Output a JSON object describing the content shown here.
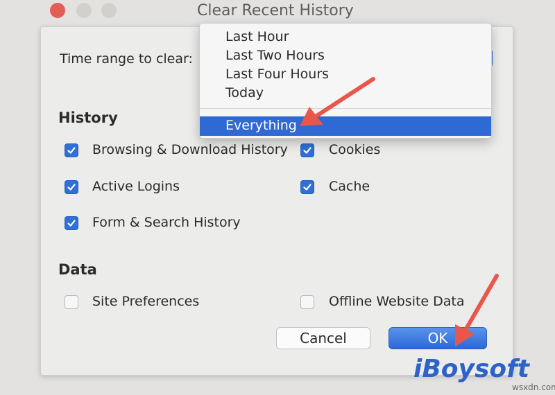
{
  "window": {
    "title": "Clear Recent History"
  },
  "time_range": {
    "label": "Time range to clear:",
    "options": [
      "Last Hour",
      "Last Two Hours",
      "Last Four Hours",
      "Today",
      "Everything"
    ],
    "selected": "Everything"
  },
  "history": {
    "heading": "History",
    "items": [
      {
        "label": "Browsing & Download History",
        "checked": true
      },
      {
        "label": "Cookies",
        "checked": true
      },
      {
        "label": "Active Logins",
        "checked": true
      },
      {
        "label": "Cache",
        "checked": true
      },
      {
        "label": "Form & Search History",
        "checked": true
      }
    ]
  },
  "data": {
    "heading": "Data",
    "items": [
      {
        "label": "Site Preferences",
        "checked": false
      },
      {
        "label": "Offline Website Data",
        "checked": false
      }
    ]
  },
  "buttons": {
    "cancel": "Cancel",
    "ok": "OK"
  },
  "branding": {
    "logo": "iBoysoft",
    "watermark": "wsxdn.com"
  },
  "colors": {
    "accent": "#2f6fd6",
    "annotation_arrow": "#e8574a"
  }
}
